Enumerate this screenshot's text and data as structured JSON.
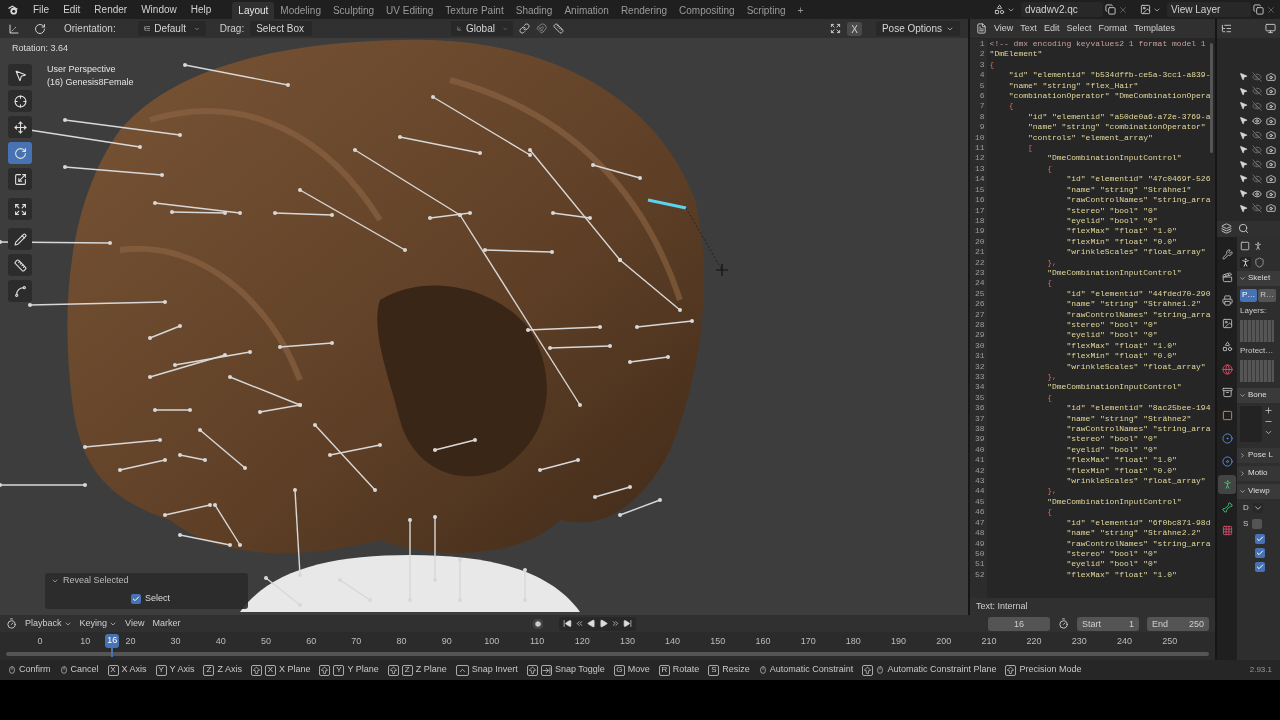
{
  "topbar": {
    "menus": [
      "File",
      "Edit",
      "Render",
      "Window",
      "Help"
    ],
    "workspaces": [
      {
        "label": "Layout",
        "selected": true
      },
      {
        "label": "Modeling",
        "selected": false
      },
      {
        "label": "Sculpting",
        "selected": false
      },
      {
        "label": "UV Editing",
        "selected": false
      },
      {
        "label": "Texture Paint",
        "selected": false
      },
      {
        "label": "Shading",
        "selected": false
      },
      {
        "label": "Animation",
        "selected": false
      },
      {
        "label": "Rendering",
        "selected": false
      },
      {
        "label": "Compositing",
        "selected": false
      },
      {
        "label": "Scripting",
        "selected": false
      }
    ],
    "add_workspace": "+",
    "scene": "dvadwv2.qc",
    "view_layer": "View Layer"
  },
  "viewport": {
    "header": {
      "orientation_label": "Orientation:",
      "orientation": "Default",
      "drag_label": "Drag:",
      "drag": "Select Box",
      "transform_space": "Global",
      "mirror_axis": "X",
      "pose_options": "Pose Options"
    },
    "operator_info": "Rotation: 3.64",
    "view_name": "User Perspective",
    "object_info": "(16) Genesis8Female",
    "tools": [
      {
        "kind": "select",
        "selected": false
      },
      {
        "kind": "cursor",
        "selected": false
      },
      {
        "kind": "move",
        "selected": false
      },
      {
        "kind": "rotate",
        "selected": true
      },
      {
        "kind": "scale",
        "selected": false
      },
      {
        "kind": "transform",
        "selected": false
      },
      {
        "kind": "annotate",
        "selected": false
      },
      {
        "kind": "measure",
        "selected": false
      },
      {
        "kind": "roll",
        "selected": false
      }
    ],
    "redo_panel": {
      "title": "Reveal Selected",
      "option": {
        "label": "Select",
        "checked": true
      }
    }
  },
  "text_editor": {
    "menus": [
      "View",
      "Text",
      "Edit",
      "Select",
      "Format",
      "Templates"
    ],
    "lines": [
      {
        "number": "1",
        "kind": "comment",
        "text": "<!-- dmx encoding keyvalues2 1 format model 1"
      },
      {
        "number": "2",
        "kind": "string",
        "text": "\"DmElement\""
      },
      {
        "number": "3",
        "kind": "brace",
        "text": "{"
      },
      {
        "number": "4",
        "kind": "string",
        "text": "    \"id\" \"elementid\" \"b534dffb-ce5a-3cc1-a839-"
      },
      {
        "number": "5",
        "kind": "string",
        "text": "    \"name\" \"string\" \"flex_Hair\""
      },
      {
        "number": "6",
        "kind": "string",
        "text": "    \"combinationOperator\" \"DmeCombinationOpera"
      },
      {
        "number": "7",
        "kind": "brace",
        "text": "    {"
      },
      {
        "number": "8",
        "kind": "string",
        "text": "        \"id\" \"elementid\" \"a50de0a6-a72e-3769-a"
      },
      {
        "number": "9",
        "kind": "string",
        "text": "        \"name\" \"string\" \"combinationOperator\""
      },
      {
        "number": "10",
        "kind": "string",
        "text": "        \"controls\" \"element_array\""
      },
      {
        "number": "11",
        "kind": "brace",
        "text": "        ["
      },
      {
        "number": "12",
        "kind": "string",
        "text": "            \"DmeCombinationInputControl\""
      },
      {
        "number": "13",
        "kind": "brace",
        "text": "            {"
      },
      {
        "number": "14",
        "kind": "string",
        "text": "                \"id\" \"elementid\" \"47c0469f-526"
      },
      {
        "number": "15",
        "kind": "string",
        "text": "                \"name\" \"string\" \"Strähne1\""
      },
      {
        "number": "16",
        "kind": "string",
        "text": "                \"rawControlNames\" \"string_arra"
      },
      {
        "number": "17",
        "kind": "string",
        "text": "                \"stereo\" \"bool\" \"0\""
      },
      {
        "number": "18",
        "kind": "string",
        "text": "                \"eyelid\" \"bool\" \"0\""
      },
      {
        "number": "19",
        "kind": "string",
        "text": "                \"flexMax\" \"float\" \"1.0\""
      },
      {
        "number": "20",
        "kind": "string",
        "text": "                \"flexMin\" \"float\" \"0.0\""
      },
      {
        "number": "21",
        "kind": "string",
        "text": "                \"wrinkleScales\" \"float_array\""
      },
      {
        "number": "22",
        "kind": "brace",
        "text": "            },"
      },
      {
        "number": "23",
        "kind": "string",
        "text": "            \"DmeCombinationInputControl\""
      },
      {
        "number": "24",
        "kind": "brace",
        "text": "            {"
      },
      {
        "number": "25",
        "kind": "string",
        "text": "                \"id\" \"elementid\" \"44fded70-290"
      },
      {
        "number": "26",
        "kind": "string",
        "text": "                \"name\" \"string\" \"Strähne1.2\""
      },
      {
        "number": "27",
        "kind": "string",
        "text": "                \"rawControlNames\" \"string_arra"
      },
      {
        "number": "28",
        "kind": "string",
        "text": "                \"stereo\" \"bool\" \"0\""
      },
      {
        "number": "29",
        "kind": "string",
        "text": "                \"eyelid\" \"bool\" \"0\""
      },
      {
        "number": "30",
        "kind": "string",
        "text": "                \"flexMax\" \"float\" \"1.0\""
      },
      {
        "number": "31",
        "kind": "string",
        "text": "                \"flexMin\" \"float\" \"0.0\""
      },
      {
        "number": "32",
        "kind": "string",
        "text": "                \"wrinkleScales\" \"float_array\""
      },
      {
        "number": "33",
        "kind": "brace",
        "text": "            },"
      },
      {
        "number": "34",
        "kind": "string",
        "text": "            \"DmeCombinationInputControl\""
      },
      {
        "number": "35",
        "kind": "brace",
        "text": "            {"
      },
      {
        "number": "36",
        "kind": "string",
        "text": "                \"id\" \"elementid\" \"8ac25bee-194"
      },
      {
        "number": "37",
        "kind": "string",
        "text": "                \"name\" \"string\" \"Strähne2\""
      },
      {
        "number": "38",
        "kind": "string",
        "text": "                \"rawControlNames\" \"string_arra"
      },
      {
        "number": "39",
        "kind": "string",
        "text": "                \"stereo\" \"bool\" \"0\""
      },
      {
        "number": "40",
        "kind": "string",
        "text": "                \"eyelid\" \"bool\" \"0\""
      },
      {
        "number": "41",
        "kind": "string",
        "text": "                \"flexMax\" \"float\" \"1.0\""
      },
      {
        "number": "42",
        "kind": "string",
        "text": "                \"flexMin\" \"float\" \"0.0\""
      },
      {
        "number": "43",
        "kind": "string",
        "text": "                \"wrinkleScales\" \"float_array\""
      },
      {
        "number": "44",
        "kind": "brace",
        "text": "            },"
      },
      {
        "number": "45",
        "kind": "string",
        "text": "            \"DmeCombinationInputControl\""
      },
      {
        "number": "46",
        "kind": "brace",
        "text": "            {"
      },
      {
        "number": "47",
        "kind": "string",
        "text": "                \"id\" \"elementid\" \"6f0bc871-98d"
      },
      {
        "number": "48",
        "kind": "string",
        "text": "                \"name\" \"string\" \"Strähne2.2\""
      },
      {
        "number": "49",
        "kind": "string",
        "text": "                \"rawControlNames\" \"string_arra"
      },
      {
        "number": "50",
        "kind": "string",
        "text": "                \"stereo\" \"bool\" \"0\""
      },
      {
        "number": "51",
        "kind": "string",
        "text": "                \"eyelid\" \"bool\" \"0\""
      },
      {
        "number": "52",
        "kind": "string",
        "text": "                \"flexMax\" \"float\" \"1.0\""
      }
    ],
    "footer": "Text: Internal"
  },
  "outliner": {
    "rows": [
      {
        "visible": false
      },
      {
        "visible": false
      },
      {
        "visible": false
      },
      {
        "visible": true
      },
      {
        "visible": false
      },
      {
        "visible": false
      },
      {
        "visible": false
      },
      {
        "visible": false
      },
      {
        "visible": true
      },
      {
        "visible": false
      }
    ]
  },
  "properties": {
    "tabs": [
      {
        "kind": "tool",
        "selected": false
      },
      {
        "kind": "render",
        "selected": false
      },
      {
        "kind": "output",
        "selected": false
      },
      {
        "kind": "view_layer",
        "selected": false
      },
      {
        "kind": "scene",
        "selected": false
      },
      {
        "kind": "world",
        "selected": false
      },
      {
        "kind": "collection",
        "selected": false
      },
      {
        "kind": "object",
        "selected": false
      },
      {
        "kind": "physics",
        "selected": false
      },
      {
        "kind": "constraints",
        "selected": false
      },
      {
        "kind": "data",
        "selected": true
      },
      {
        "kind": "bone",
        "selected": false
      },
      {
        "kind": "texture",
        "selected": false
      }
    ],
    "panels": [
      {
        "kind": "skeleton",
        "title": "Skelet",
        "expanded": true,
        "positions": [
          {
            "label": "P…",
            "selected": true
          },
          {
            "label": "R…",
            "selected": false
          }
        ],
        "layers_label": "Layers:",
        "protected_label": "Protect…"
      },
      {
        "kind": "bone_groups",
        "title": "Bone",
        "expanded": true
      },
      {
        "kind": "section",
        "title": "Pose L",
        "expanded": false
      },
      {
        "kind": "section",
        "title": "Motio",
        "expanded": false
      },
      {
        "kind": "viewport_display",
        "title": "Viewp",
        "expanded": true,
        "display_label": "D",
        "shape_label": "S",
        "options": [
          {
            "checked": true
          },
          {
            "checked": true
          },
          {
            "checked": true
          }
        ]
      }
    ]
  },
  "timeline": {
    "dropdown_menus": [
      "Playback",
      "Keying"
    ],
    "menus": [
      "View",
      "Marker"
    ],
    "current_frame": "16",
    "playhead": "16",
    "start_label": "Start",
    "start": "1",
    "end_label": "End",
    "end": "250",
    "ticks": [
      "0",
      "10",
      "20",
      "30",
      "40",
      "50",
      "60",
      "70",
      "80",
      "90",
      "100",
      "110",
      "120",
      "130",
      "140",
      "150",
      "160",
      "170",
      "180",
      "190",
      "200",
      "210",
      "220",
      "230",
      "240",
      "250"
    ]
  },
  "status_bar": {
    "items": [
      {
        "label": "Confirm",
        "keys": [
          {
            "kind": "mouse"
          }
        ]
      },
      {
        "label": "Cancel",
        "keys": [
          {
            "kind": "mouse"
          }
        ]
      },
      {
        "label": "X Axis",
        "keys": [
          {
            "kind": "key",
            "label": "X"
          }
        ]
      },
      {
        "label": "Y Axis",
        "keys": [
          {
            "kind": "key",
            "label": "Y"
          }
        ]
      },
      {
        "label": "Z Axis",
        "keys": [
          {
            "kind": "key",
            "label": "Z"
          }
        ]
      },
      {
        "label": "X Plane",
        "keys": [
          {
            "kind": "shift"
          },
          {
            "kind": "key",
            "label": "X"
          }
        ]
      },
      {
        "label": "Y Plane",
        "keys": [
          {
            "kind": "shift"
          },
          {
            "kind": "key",
            "label": "Y"
          }
        ]
      },
      {
        "label": "Z Plane",
        "keys": [
          {
            "kind": "shift"
          },
          {
            "kind": "key",
            "label": "Z"
          }
        ]
      },
      {
        "label": "Snap Invert",
        "keys": [
          {
            "kind": "ctrl"
          }
        ]
      },
      {
        "label": "Snap Toggle",
        "keys": [
          {
            "kind": "shift"
          },
          {
            "kind": "tab"
          }
        ]
      },
      {
        "label": "Move",
        "keys": [
          {
            "kind": "key",
            "label": "G"
          }
        ]
      },
      {
        "label": "Rotate",
        "keys": [
          {
            "kind": "key",
            "label": "R"
          }
        ]
      },
      {
        "label": "Resize",
        "keys": [
          {
            "kind": "key",
            "label": "S"
          }
        ]
      },
      {
        "label": "Automatic Constraint",
        "keys": [
          {
            "kind": "mouse"
          }
        ]
      },
      {
        "label": "Automatic Constraint Plane",
        "keys": [
          {
            "kind": "shift"
          },
          {
            "kind": "mouse"
          }
        ]
      },
      {
        "label": "Precision Mode",
        "keys": [
          {
            "kind": "shift"
          }
        ]
      }
    ],
    "version": "2.93.1"
  }
}
